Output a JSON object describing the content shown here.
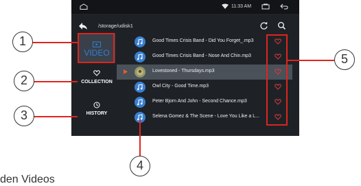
{
  "status_bar": {
    "time": "11:33 AM"
  },
  "path_bar": {
    "path": "/storage/udisk1"
  },
  "sidebar": {
    "video_label": "VIDEO",
    "collection_label": "COLLECTION",
    "history_label": "HISTORY"
  },
  "files": [
    {
      "title": "Good Times Crisis Band - Did You Forget_.mp3"
    },
    {
      "title": "Good Times Crisis Band - Nose And Chin.mp3"
    },
    {
      "title": "Lovestoned - Thursdays.mp3"
    },
    {
      "title": "Owl City - Good Time.mp3"
    },
    {
      "title": "Peter Bjorn And John - Second Chance.mp3"
    },
    {
      "title": "Selena Gomez & The Scene - Love You Like a L..."
    }
  ],
  "callouts": {
    "c1": "1",
    "c2": "2",
    "c3": "3",
    "c4": "4",
    "c5": "5"
  },
  "caption": "den Videos",
  "colors": {
    "accent": "#2f7fd6",
    "annotation_red": "#e0241d",
    "screen_bg": "#1e2227",
    "heart_red": "#d93a3a"
  },
  "icons": [
    "home-icon",
    "wifi-icon",
    "window-icon",
    "back-icon",
    "back-arrow-icon",
    "refresh-icon",
    "search-icon",
    "video-folder-icon",
    "heart-outline-icon",
    "clock-icon",
    "music-note-icon",
    "album-art-icon",
    "play-indicator-icon"
  ]
}
